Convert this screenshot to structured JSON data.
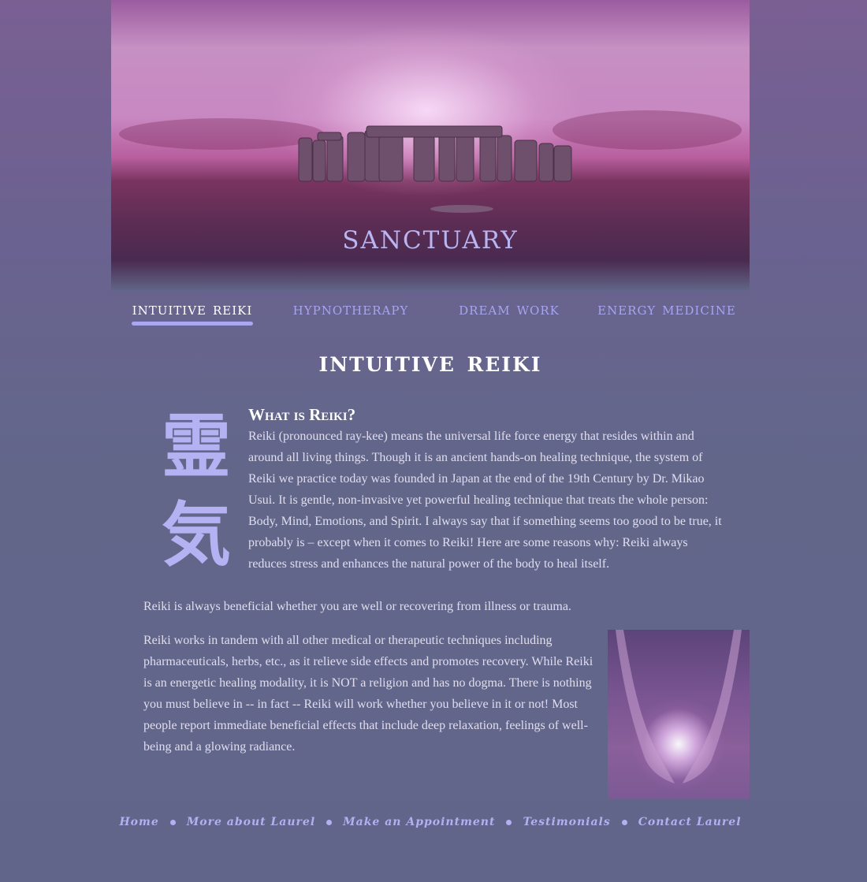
{
  "banner": {
    "title": "sanctuary"
  },
  "nav": {
    "items": [
      {
        "label": "intuitive reiki",
        "active": true
      },
      {
        "label": "hypnotherapy",
        "active": false
      },
      {
        "label": "dream work",
        "active": false
      },
      {
        "label": "energy medicine",
        "active": false
      }
    ]
  },
  "main": {
    "page_title": "intuitive reiki",
    "kanji": {
      "top": "霊",
      "bottom": "気"
    },
    "section_heading": "What is Reiki?",
    "paragraphs": [
      "Reiki (pronounced ray-kee) means the universal life force energy that resides within and around all living things. Though it is an ancient hands-on healing technique, the system of Reiki we practice today was founded in Japan at the end of the 19th Century by Dr. Mikao Usui. It is gentle, non-invasive yet powerful healing technique that treats the whole person: Body, Mind, Emotions, and Spirit. I always say that if something seems too good to be true, it probably is – except when it comes to Reiki! Here are some reasons why: Reiki always reduces stress and enhances the natural power of the body to heal itself.",
      "Reiki is always beneficial whether you are well or recovering from illness or trauma.",
      "Reiki works in tandem with all other medical or therapeutic techniques including pharmaceuticals, herbs, etc., as it relieve side effects and promotes recovery. While Reiki is an energetic healing modality, it is NOT a religion and has no dogma. There is nothing you must believe in -- in fact -- Reiki will work whether you believe in it or not! Most people report immediate beneficial effects that include deep relaxation, feelings of well-being and a glowing radiance."
    ]
  },
  "footer": {
    "links": [
      "Home",
      "More about Laurel",
      "Make an Appointment",
      "Testimonials",
      "Contact Laurel"
    ]
  },
  "colors": {
    "background": "#62678a",
    "accent": "#a9a7ef",
    "text": "#e0ddee"
  }
}
